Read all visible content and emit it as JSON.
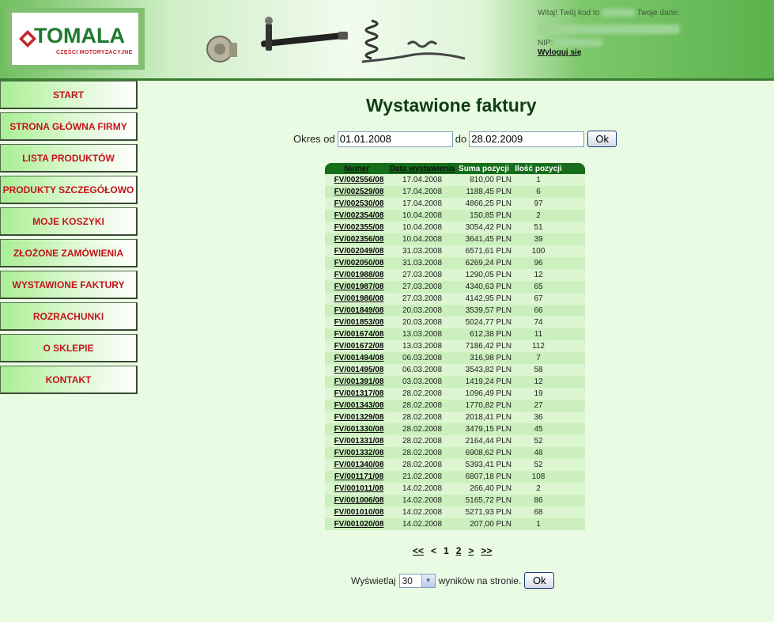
{
  "brand": {
    "name": "TOMALA",
    "subtitle": "CZĘŚCI MOTORYZACYJNE"
  },
  "user": {
    "greeting": "Witaj! Twój kod to",
    "data_label": "Twoje dane:",
    "nip_label": "NIP:",
    "logout_label": "Wyloguj się"
  },
  "nav": [
    {
      "label": "START"
    },
    {
      "label": "STRONA GŁÓWNA FIRMY"
    },
    {
      "label": "LISTA PRODUKTÓW"
    },
    {
      "label": "PRODUKTY SZCZEGÓŁOWO"
    },
    {
      "label": "MOJE KOSZYKI"
    },
    {
      "label": "ZŁOŻONE ZAMÓWIENIA"
    },
    {
      "label": "WYSTAWIONE FAKTURY"
    },
    {
      "label": "ROZRACHUNKI"
    },
    {
      "label": "O SKLEPIE"
    },
    {
      "label": "KONTAKT"
    }
  ],
  "page_title": "Wystawione faktury",
  "filter": {
    "from_label": "Okres od",
    "from_value": "01.01.2008",
    "to_label": "do",
    "to_value": "28.02.2009",
    "ok_label": "Ok"
  },
  "table": {
    "headers": [
      "Numer",
      "Data wystawienia",
      "Suma pozycji",
      "Ilość pozycji"
    ],
    "rows": [
      [
        "FV/002556/08",
        "17.04.2008",
        "810,00 PLN",
        "1"
      ],
      [
        "FV/002529/08",
        "17.04.2008",
        "1188,45 PLN",
        "6"
      ],
      [
        "FV/002530/08",
        "17.04.2008",
        "4866,25 PLN",
        "97"
      ],
      [
        "FV/002354/08",
        "10.04.2008",
        "150,85 PLN",
        "2"
      ],
      [
        "FV/002355/08",
        "10.04.2008",
        "3054,42 PLN",
        "51"
      ],
      [
        "FV/002356/08",
        "10.04.2008",
        "3641,45 PLN",
        "39"
      ],
      [
        "FV/002049/08",
        "31.03.2008",
        "6571,61 PLN",
        "100"
      ],
      [
        "FV/002050/08",
        "31.03.2008",
        "6269,24 PLN",
        "96"
      ],
      [
        "FV/001988/08",
        "27.03.2008",
        "1290,05 PLN",
        "12"
      ],
      [
        "FV/001987/08",
        "27.03.2008",
        "4340,63 PLN",
        "65"
      ],
      [
        "FV/001986/08",
        "27.03.2008",
        "4142,95 PLN",
        "67"
      ],
      [
        "FV/001849/08",
        "20.03.2008",
        "3539,57 PLN",
        "66"
      ],
      [
        "FV/001853/08",
        "20.03.2008",
        "5024,77 PLN",
        "74"
      ],
      [
        "FV/001674/08",
        "13.03.2008",
        "612,38 PLN",
        "11"
      ],
      [
        "FV/001672/08",
        "13.03.2008",
        "7186,42 PLN",
        "112"
      ],
      [
        "FV/001494/08",
        "06.03.2008",
        "316,98 PLN",
        "7"
      ],
      [
        "FV/001495/08",
        "06.03.2008",
        "3543,82 PLN",
        "58"
      ],
      [
        "FV/001391/08",
        "03.03.2008",
        "1419,24 PLN",
        "12"
      ],
      [
        "FV/001317/08",
        "28.02.2008",
        "1096,49 PLN",
        "19"
      ],
      [
        "FV/001343/08",
        "28.02.2008",
        "1770,82 PLN",
        "27"
      ],
      [
        "FV/001329/08",
        "28.02.2008",
        "2018,41 PLN",
        "36"
      ],
      [
        "FV/001330/08",
        "28.02.2008",
        "3479,15 PLN",
        "45"
      ],
      [
        "FV/001331/08",
        "28.02.2008",
        "2164,44 PLN",
        "52"
      ],
      [
        "FV/001332/08",
        "28.02.2008",
        "6908,62 PLN",
        "48"
      ],
      [
        "FV/001340/08",
        "28.02.2008",
        "5393,41 PLN",
        "52"
      ],
      [
        "FV/001171/08",
        "21.02.2008",
        "6807,18 PLN",
        "108"
      ],
      [
        "FV/001011/08",
        "14.02.2008",
        "266,40 PLN",
        "2"
      ],
      [
        "FV/001006/08",
        "14.02.2008",
        "5165,72 PLN",
        "86"
      ],
      [
        "FV/001010/08",
        "14.02.2008",
        "5271,93 PLN",
        "68"
      ],
      [
        "FV/001020/08",
        "14.02.2008",
        "207,00 PLN",
        "1"
      ]
    ]
  },
  "pager": {
    "first": "<<",
    "prev": "<",
    "current": "1",
    "next_page": "2",
    "next": ">",
    "last": ">>"
  },
  "per_page": {
    "prefix": "Wyświetlaj",
    "value": "30",
    "suffix": "wyników na stronie.",
    "ok_label": "Ok"
  },
  "colors": {
    "header_green": "#5bb24d",
    "nav_text": "#c4141b",
    "table_header": "#166e1b",
    "page_bg": "#e9fbe3"
  }
}
